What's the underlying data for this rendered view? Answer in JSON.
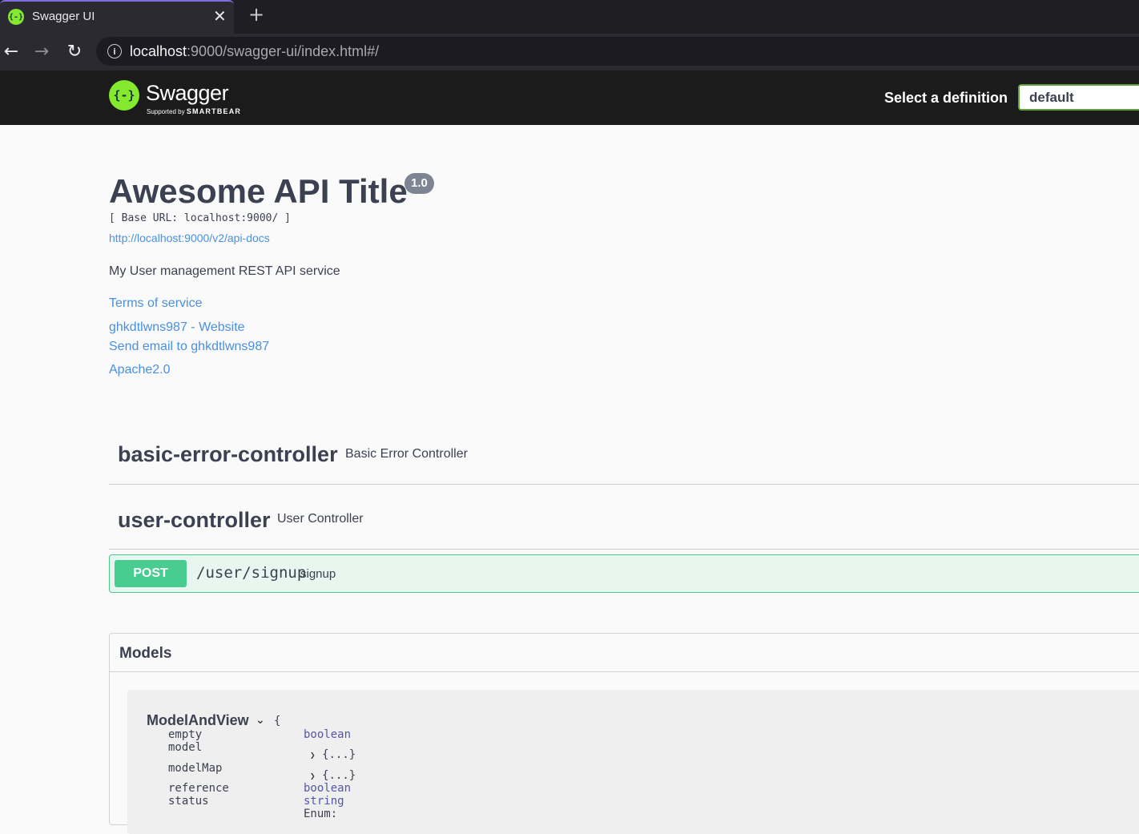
{
  "browser": {
    "tab_title": "Swagger UI",
    "favicon_text": "{-}",
    "close_glyph": "✕",
    "new_tab_glyph": "+",
    "url_host": "localhost",
    "url_rest": ":9000/swagger-ui/index.html#/",
    "back_glyph": "←",
    "forward_glyph": "→",
    "reload_glyph": "↻",
    "info_glyph": "i"
  },
  "topbar": {
    "logo_mark": "{-}",
    "logo_text": "Swagger",
    "supported_by": "Supported by",
    "smartbear": "SMARTBEAR",
    "definition_label": "Select a definition",
    "definition_value": "default",
    "accent_color": "#85ea2d"
  },
  "info": {
    "title": "Awesome API Title",
    "version": "1.0",
    "base_url": "[ Base URL: localhost:9000/ ]",
    "docs_url": "http://localhost:9000/v2/api-docs",
    "description": "My User management REST API service",
    "terms": "Terms of service",
    "contact_website": "ghkdtlwns987 - Website",
    "contact_email": "Send email to ghkdtlwns987",
    "license": "Apache2.0"
  },
  "tags": [
    {
      "name": "basic-error-controller",
      "description": "Basic Error Controller"
    },
    {
      "name": "user-controller",
      "description": "User Controller"
    }
  ],
  "operation": {
    "method": "POST",
    "path": "/user/signup",
    "summary": "signup",
    "method_color": "#49cc90"
  },
  "models": {
    "title": "Models",
    "model_name": "ModelAndView",
    "toggle_glyph": "⌄",
    "open_brace": "{",
    "properties": [
      {
        "name": "empty",
        "type": "boolean"
      },
      {
        "name": "model",
        "type": "{...}"
      },
      {
        "name": "modelMap",
        "type": "{...}"
      },
      {
        "name": "reference",
        "type": "boolean"
      },
      {
        "name": "status",
        "type": "string"
      }
    ],
    "expand_glyph": "❯",
    "enum_partial": "Enum:"
  }
}
